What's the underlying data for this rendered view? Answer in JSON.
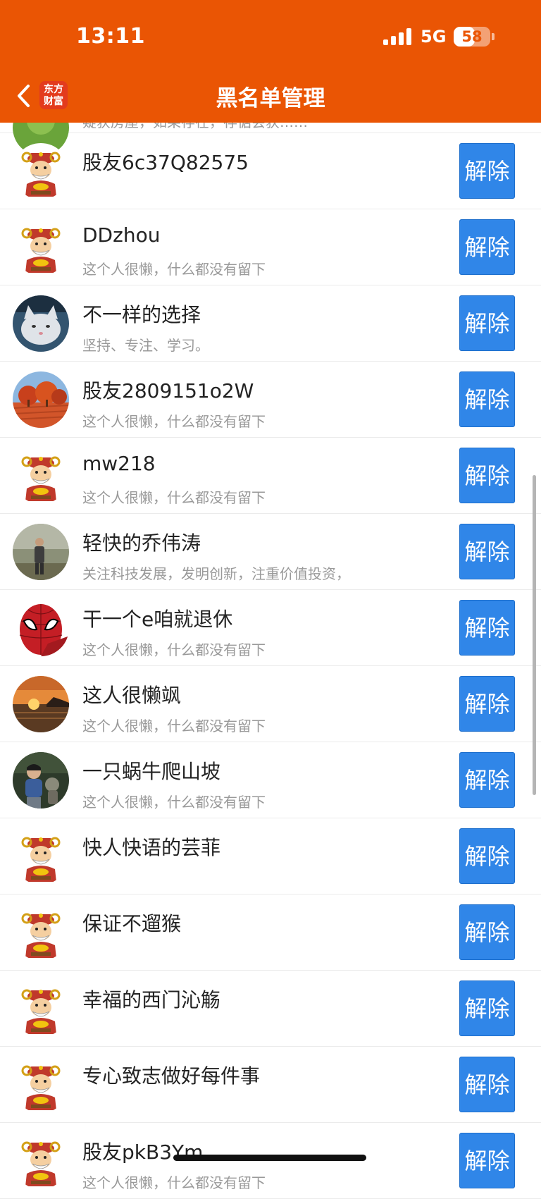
{
  "status_bar": {
    "time": "13:11",
    "network": "5G",
    "battery": "58",
    "battery_level": 0.58
  },
  "nav": {
    "title": "黑名单管理",
    "logo_line1": "东方",
    "logo_line2": "财富"
  },
  "colors": {
    "header": "#ea5504",
    "button": "#3086e8"
  },
  "users": [
    {
      "name": "",
      "bio": "疑获房屋，如果存在，存惦会获……",
      "avatar": "green-avatar",
      "button": ""
    },
    {
      "name": "股友6c37Q82575",
      "bio": "",
      "avatar": "default-fortune-god-avatar",
      "button": "解除"
    },
    {
      "name": "DDzhou",
      "bio": "这个人很懒，什么都没有留下",
      "avatar": "default-fortune-god-avatar",
      "button": "解除"
    },
    {
      "name": "不一样的选择",
      "bio": "坚持、专注、学习。",
      "avatar": "cat-photo-avatar",
      "button": "解除"
    },
    {
      "name": "股友2809151o2W",
      "bio": "这个人很懒，什么都没有留下",
      "avatar": "red-trees-photo-avatar",
      "button": "解除"
    },
    {
      "name": "mw218",
      "bio": "这个人很懒，什么都没有留下",
      "avatar": "default-fortune-god-avatar",
      "button": "解除"
    },
    {
      "name": "轻快的乔伟涛",
      "bio": "关注科技发展，发明创新，注重价值投资，",
      "avatar": "person-outdoor-photo-avatar",
      "button": "解除"
    },
    {
      "name": "干一个e咱就退休",
      "bio": "这个人很懒，什么都没有留下",
      "avatar": "spiderman-avatar",
      "button": "解除"
    },
    {
      "name": "这人很懒飒",
      "bio": "这个人很懒，什么都没有留下",
      "avatar": "sunset-photo-avatar",
      "button": "解除"
    },
    {
      "name": "一只蜗牛爬山坡",
      "bio": "这个人很懒，什么都没有留下",
      "avatar": "child-photo-avatar",
      "button": "解除"
    },
    {
      "name": "快人快语的芸菲",
      "bio": "",
      "avatar": "default-fortune-god-avatar",
      "button": "解除"
    },
    {
      "name": "保证不遛猴",
      "bio": "",
      "avatar": "default-fortune-god-avatar",
      "button": "解除"
    },
    {
      "name": "幸福的西门沁觞",
      "bio": "",
      "avatar": "default-fortune-god-avatar",
      "button": "解除"
    },
    {
      "name": "专心致志做好每件事",
      "bio": "",
      "avatar": "default-fortune-god-avatar",
      "button": "解除"
    },
    {
      "name": "股友pkB3Ym",
      "bio": "这个人很懒，什么都没有留下",
      "avatar": "default-fortune-god-avatar",
      "button": "解除"
    }
  ]
}
